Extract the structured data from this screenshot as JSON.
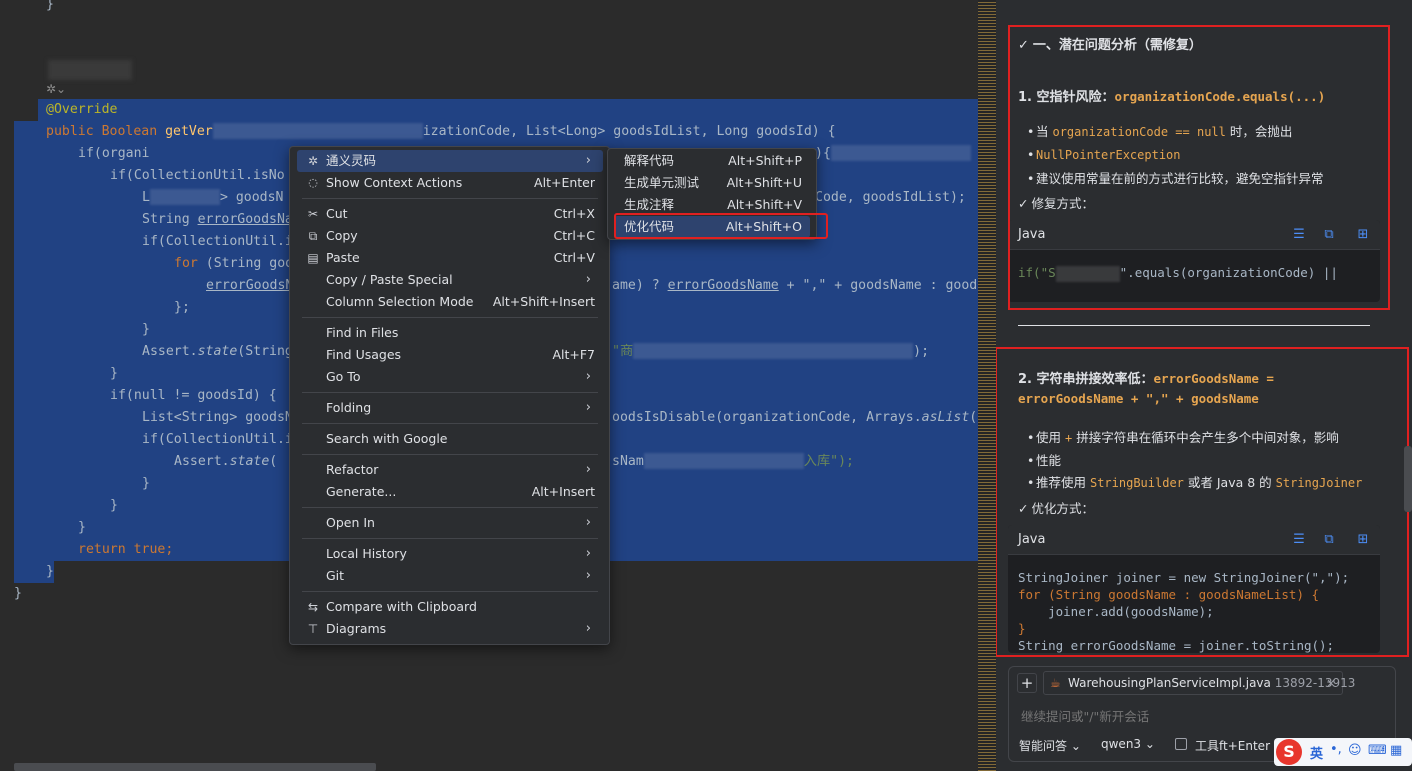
{
  "editor": {
    "lines": [
      {
        "n": "brace_top",
        "text": "}"
      },
      {
        "n": "annotation",
        "text": "@Override"
      },
      {
        "n": "sig_kw",
        "text": "public Boolean "
      },
      {
        "n": "sig_fn",
        "text": "getVer"
      },
      {
        "n": "sig_rest",
        "text": "izationCode, List<Long> goodsIdList, Long goodsId) {"
      },
      {
        "n": "l_if1",
        "text": "if(organi"
      },
      {
        "n": "l_if1_tail",
        "text": "){"
      },
      {
        "n": "l_if2",
        "text": "if(CollectionUtil.isNo"
      },
      {
        "n": "l_list",
        "text": "L"
      },
      {
        "n": "l_list2",
        "text": "> goodsN"
      },
      {
        "n": "l_list_tail",
        "text": "Code, goodsIdList);"
      },
      {
        "n": "l_str",
        "text": "String "
      },
      {
        "n": "l_str2",
        "text": "errorGoodsNa"
      },
      {
        "n": "l_if3",
        "text": "if(CollectionUtil.i"
      },
      {
        "n": "l_for",
        "text": "for "
      },
      {
        "n": "l_for2",
        "text": "(String goo"
      },
      {
        "n": "l_err",
        "text": "errorGoodsN"
      },
      {
        "n": "l_err_tail1",
        "text": "ame) ? "
      },
      {
        "n": "l_err_tail2",
        "text": "errorGoodsName"
      },
      {
        "n": "l_err_tail3",
        "text": " + \",\" + goodsName : goodsN"
      },
      {
        "n": "l_semi",
        "text": "};"
      },
      {
        "n": "l_close",
        "text": "}"
      },
      {
        "n": "l_assert",
        "text": "Assert."
      },
      {
        "n": "l_assert2",
        "text": "state"
      },
      {
        "n": "l_assert3",
        "text": "(String"
      },
      {
        "n": "l_assert_tail",
        "text": "\"商"
      },
      {
        "n": "l_assert_end",
        "text": ");"
      },
      {
        "n": "l_close2",
        "text": "}"
      },
      {
        "n": "l_if4",
        "text": "if(null != goodsId) {"
      },
      {
        "n": "l_list3",
        "text": "List<String> goodsN"
      },
      {
        "n": "l_list3_tail",
        "text": "oodsIsDisable(organizationCode, Arrays."
      },
      {
        "n": "l_list3_tail2",
        "text": "asList"
      },
      {
        "n": "l_list3_tail3",
        "text": "(go"
      },
      {
        "n": "l_if5",
        "text": "if(CollectionUtil.i"
      },
      {
        "n": "l_assert4",
        "text": "Assert."
      },
      {
        "n": "l_assert5",
        "text": "state"
      },
      {
        "n": "l_assert6",
        "text": "( "
      },
      {
        "n": "l_assert4_tail",
        "text": "sNam"
      },
      {
        "n": "l_assert4_tail2",
        "text": "入库\");"
      },
      {
        "n": "l_close3",
        "text": "}"
      },
      {
        "n": "l_close4",
        "text": "}"
      },
      {
        "n": "l_close5",
        "text": "}"
      },
      {
        "n": "l_return",
        "text": "return true;"
      },
      {
        "n": "l_close6",
        "text": "}"
      },
      {
        "n": "l_close7",
        "text": "}"
      }
    ]
  },
  "context_menu": {
    "items": [
      {
        "icon": "tongyi-icon",
        "glyph": "✲",
        "label": "通义灵码",
        "shortcut": "",
        "arrow": true
      },
      {
        "icon": "bulb-icon",
        "glyph": "💡",
        "label": "Show Context Actions",
        "shortcut": "Alt+Enter",
        "arrow": false
      },
      {
        "icon": "cut-icon",
        "glyph": "✂",
        "label": "Cut",
        "shortcut": "Ctrl+X",
        "arrow": false
      },
      {
        "icon": "copy-icon",
        "glyph": "⧉",
        "label": "Copy",
        "shortcut": "Ctrl+C",
        "arrow": false
      },
      {
        "icon": "paste-icon",
        "glyph": "▤",
        "label": "Paste",
        "shortcut": "Ctrl+V",
        "arrow": false
      },
      {
        "icon": "",
        "glyph": "",
        "label": "Copy / Paste Special",
        "shortcut": "",
        "arrow": true
      },
      {
        "icon": "",
        "glyph": "",
        "label": "Column Selection Mode",
        "shortcut": "Alt+Shift+Insert",
        "arrow": false
      },
      {
        "icon": "",
        "glyph": "",
        "label": "Find in Files",
        "shortcut": "",
        "arrow": false
      },
      {
        "icon": "",
        "glyph": "",
        "label": "Find Usages",
        "shortcut": "Alt+F7",
        "arrow": false
      },
      {
        "icon": "",
        "glyph": "",
        "label": "Go To",
        "shortcut": "",
        "arrow": true
      },
      {
        "icon": "",
        "glyph": "",
        "label": "Folding",
        "shortcut": "",
        "arrow": true
      },
      {
        "icon": "",
        "glyph": "",
        "label": "Search with Google",
        "shortcut": "",
        "arrow": false
      },
      {
        "icon": "",
        "glyph": "",
        "label": "Refactor",
        "shortcut": "",
        "arrow": true
      },
      {
        "icon": "",
        "glyph": "",
        "label": "Generate...",
        "shortcut": "Alt+Insert",
        "arrow": false
      },
      {
        "icon": "",
        "glyph": "",
        "label": "Open In",
        "shortcut": "",
        "arrow": true
      },
      {
        "icon": "",
        "glyph": "",
        "label": "Local History",
        "shortcut": "",
        "arrow": true
      },
      {
        "icon": "",
        "glyph": "",
        "label": "Git",
        "shortcut": "",
        "arrow": true
      },
      {
        "icon": "compare-icon",
        "glyph": "⇆",
        "label": "Compare with Clipboard",
        "shortcut": "",
        "arrow": false
      },
      {
        "icon": "diagram-icon",
        "glyph": "⊤",
        "label": "Diagrams",
        "shortcut": "",
        "arrow": true
      }
    ]
  },
  "submenu": {
    "items": [
      {
        "label": "解释代码",
        "shortcut": "Alt+Shift+P"
      },
      {
        "label": "生成单元测试",
        "shortcut": "Alt+Shift+U"
      },
      {
        "label": "生成注释",
        "shortcut": "Alt+Shift+V"
      },
      {
        "label": "优化代码",
        "shortcut": "Alt+Shift+O"
      }
    ]
  },
  "panel": {
    "section1_title": "一、潜在问题分析（需修复）",
    "issue1_title": "1. 空指针风险：",
    "issue1_code": "organizationCode.equals(...)",
    "issue1_b1_pre": "当 ",
    "issue1_b1_code": "organizationCode == null",
    "issue1_b1_post": " 时，会抛出",
    "issue1_b1_code2": "NullPointerException",
    "issue1_b2": "建议使用常量在前的方式进行比较，避免空指针异常",
    "fix_label1": "修复方式：",
    "lang1": "Java",
    "code1_a": "if(\"S",
    "code1_b": "\".equals(organizationCode) ||",
    "issue2_title": "2. 字符串拼接效率低：",
    "issue2_code1": "errorGoodsName =",
    "issue2_code2": "errorGoodsName + \",\" + goodsName",
    "issue2_b1_pre": "使用 ",
    "issue2_b1_code": "+",
    "issue2_b1_post": " 拼接字符串在循环中会产生多个中间对象，影响",
    "issue2_b1_post2": "性能",
    "issue2_b2_pre": "推荐使用 ",
    "issue2_b2_code": "StringBuilder",
    "issue2_b2_mid": " 或者 Java 8 的 ",
    "issue2_b2_code2": "StringJoiner",
    "fix_label2": "优化方式：",
    "lang2": "Java",
    "code2_l1": "StringJoiner joiner = new StringJoiner(\",\");",
    "code2_l2": "for (String goodsName : goodsNameList) {",
    "code2_l3": "    joiner.add(goodsName);",
    "code2_l4": "}",
    "code2_l5": "String errorGoodsName = joiner.toString();",
    "file_chip": "WarehousingPlanServiceImpl.java",
    "file_range": "13892-13913",
    "input_placeholder": "继续提问或\"/\"新开会话",
    "mode_label": "智能问答",
    "model_label": "qwen3",
    "tool_label": "工具",
    "tool_shortcut": "ft+Enter",
    "ime_label": "英"
  },
  "colors": {
    "selection": "#214283",
    "accent": "#4c8ef7",
    "highlight_red": "#e02020",
    "code_inline": "#e6a550"
  }
}
